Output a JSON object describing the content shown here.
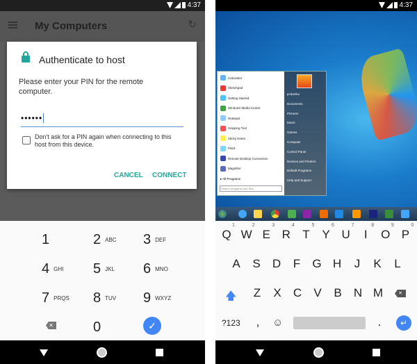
{
  "left": {
    "status": {
      "time": "4:37"
    },
    "toolbar": {
      "title": "My Computers",
      "menu_icon": "hamburger-icon",
      "refresh_icon": "refresh-icon"
    },
    "dialog": {
      "title": "Authenticate to host",
      "icon": "lock-icon",
      "message": "Please enter your PIN for the remote computer.",
      "pin_value": "••••••",
      "checkbox_label": "Don't ask for a PIN again when connecting to this host from this device.",
      "checkbox_checked": false,
      "cancel": "CANCEL",
      "connect": "CONNECT",
      "accent": "#26a69a"
    },
    "keypad": [
      {
        "d": "1",
        "l": ""
      },
      {
        "d": "2",
        "l": "ABC"
      },
      {
        "d": "3",
        "l": "DEF"
      },
      {
        "d": "4",
        "l": "GHI"
      },
      {
        "d": "5",
        "l": "JKL"
      },
      {
        "d": "6",
        "l": "MNO"
      },
      {
        "d": "7",
        "l": "PRQS"
      },
      {
        "d": "8",
        "l": "TUV"
      },
      {
        "d": "9",
        "l": "WXYZ"
      },
      {
        "d": "0",
        "l": ""
      }
    ],
    "done_color": "#4285f4"
  },
  "right": {
    "status": {
      "time": "4:37"
    },
    "start_menu": {
      "programs": [
        "Calculator",
        "Sketchpad",
        "Getting Started",
        "Windows Media Center",
        "Notepad",
        "Snipping Tool",
        "Sticky Notes",
        "Paint",
        "Remote Desktop Connection",
        "Magnifier"
      ],
      "all_programs": "All Programs",
      "search_placeholder": "Search programs and files",
      "places": [
        "pcdaniko",
        "Documents",
        "Pictures",
        "Music",
        "Games",
        "Computer",
        "Control Panel",
        "Devices and Printers",
        "Default Programs",
        "Help and Support"
      ]
    },
    "keyboard": {
      "row1": [
        "Q",
        "W",
        "E",
        "R",
        "T",
        "Y",
        "U",
        "I",
        "O",
        "P"
      ],
      "hints": [
        "1",
        "2",
        "3",
        "4",
        "5",
        "6",
        "7",
        "8",
        "9",
        "0"
      ],
      "row2": [
        "A",
        "S",
        "D",
        "F",
        "G",
        "H",
        "J",
        "K",
        "L"
      ],
      "row3": [
        "Z",
        "X",
        "C",
        "V",
        "B",
        "N",
        "M"
      ],
      "symbols": "?123",
      "comma": ",",
      "period": "."
    }
  }
}
